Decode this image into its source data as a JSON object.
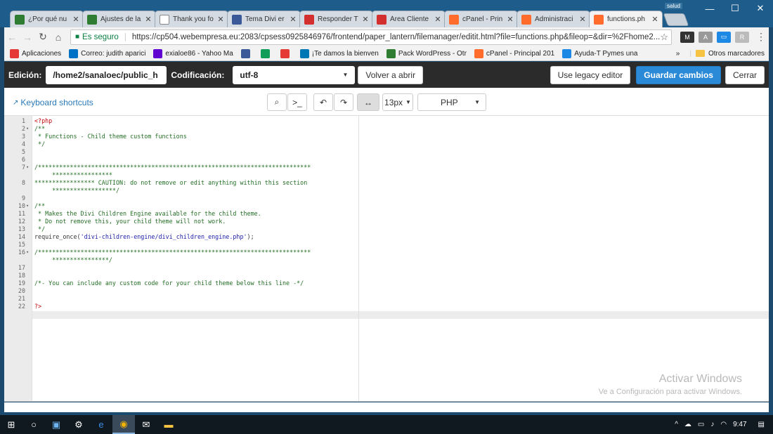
{
  "browser": {
    "tabs": [
      {
        "title": "¿Por qué nu",
        "icon": "page-icon",
        "color": "#2e7d32"
      },
      {
        "title": "Ajustes de la",
        "icon": "page-icon",
        "color": "#2e7d32"
      },
      {
        "title": "Thank you fo",
        "icon": "doc-icon",
        "color": "#ffffff"
      },
      {
        "title": "Tema Divi er",
        "icon": "facebook-icon",
        "color": "#3b5998"
      },
      {
        "title": "Responder T",
        "icon": "w-icon",
        "color": "#d32f2f"
      },
      {
        "title": "Área Cliente",
        "icon": "w-icon",
        "color": "#d32f2f"
      },
      {
        "title": "cPanel - Prin",
        "icon": "cpanel-icon",
        "color": "#ff6c2c"
      },
      {
        "title": "Administraci",
        "icon": "cpanel-icon",
        "color": "#ff6c2c"
      },
      {
        "title": "functions.ph",
        "icon": "cpanel-icon",
        "color": "#ff6c2c",
        "active": true
      }
    ],
    "profile_label": "salud",
    "window_controls": {
      "minimize": "—",
      "maximize": "☐",
      "close": "✕"
    },
    "secure_label": "Es seguro",
    "url": "https://cp504.webempresa.eu:2083/cpsess0925846976/frontend/paper_lantern/filemanager/editit.html?file=functions.php&fileop=&dir=%2Fhome2...",
    "bookmarks": [
      {
        "label": "Aplicaciones",
        "icon": "apps-icon",
        "color": "#e53935"
      },
      {
        "label": "Correo: judith aparici",
        "icon": "outlook-icon",
        "color": "#0072c6"
      },
      {
        "label": "exialoe86 - Yahoo Ma",
        "icon": "yahoo-icon",
        "color": "#6001d2"
      },
      {
        "label": "",
        "icon": "facebook-icon",
        "color": "#3b5998"
      },
      {
        "label": "",
        "icon": "chat-icon",
        "color": "#0f9d58"
      },
      {
        "label": "",
        "icon": "youtube-icon",
        "color": "#e53935"
      },
      {
        "label": "¡Te damos la bienven",
        "icon": "linkedin-icon",
        "color": "#0077b5"
      },
      {
        "label": "Pack WordPress - Otr",
        "icon": "page-icon",
        "color": "#2e7d32"
      },
      {
        "label": "cPanel - Principal 201",
        "icon": "cpanel-icon",
        "color": "#ff6c2c"
      },
      {
        "label": "Ayuda-T Pymes una",
        "icon": "ayuda-icon",
        "color": "#1e88e5"
      }
    ],
    "bookmarks_overflow": "»",
    "other_bookmarks": "Otros marcadores"
  },
  "editor_header": {
    "edit_label": "Edición:",
    "path_value": "/home2/sanaloec/public_h",
    "encoding_label": "Codificación:",
    "encoding_value": "utf-8",
    "reopen_button": "Volver a abrir",
    "legacy_button": "Use legacy editor",
    "save_button": "Guardar cambios",
    "close_button": "Cerrar"
  },
  "editor_tools": {
    "keyboard_shortcuts": "Keyboard shortcuts",
    "font_size": "13px",
    "mode": "PHP"
  },
  "code_lines": [
    {
      "n": "1",
      "fold": "",
      "text": "<?php",
      "cls": "tag"
    },
    {
      "n": "2",
      "fold": "▾",
      "text": "/**",
      "cls": "cm"
    },
    {
      "n": "3",
      "fold": "",
      "text": " * Functions - Child theme custom functions",
      "cls": "cm"
    },
    {
      "n": "4",
      "fold": "",
      "text": " */",
      "cls": "cm"
    },
    {
      "n": "5",
      "fold": "",
      "text": "",
      "cls": "cm"
    },
    {
      "n": "6",
      "fold": "",
      "text": "",
      "cls": "cm"
    },
    {
      "n": "7",
      "fold": "▾",
      "text": "/*****************************************************************************",
      "cls": "cm"
    },
    {
      "n": "",
      "fold": "",
      "text": "     *****************",
      "cls": "cm"
    },
    {
      "n": "8",
      "fold": "",
      "text": "***************** CAUTION: do not remove or edit anything within this section",
      "cls": "cm"
    },
    {
      "n": "",
      "fold": "",
      "text": "     ******************/",
      "cls": "cm"
    },
    {
      "n": "9",
      "fold": "",
      "text": "",
      "cls": "cm"
    },
    {
      "n": "10",
      "fold": "▾",
      "text": "/**",
      "cls": "cm"
    },
    {
      "n": "11",
      "fold": "",
      "text": " * Makes the Divi Children Engine available for the child theme.",
      "cls": "cm"
    },
    {
      "n": "12",
      "fold": "",
      "text": " * Do not remove this, your child theme will not work.",
      "cls": "cm"
    },
    {
      "n": "13",
      "fold": "",
      "text": " */",
      "cls": "cm"
    },
    {
      "n": "14",
      "fold": "",
      "text": "require_once('divi-children-engine/divi_children_engine.php');",
      "cls": "mixed"
    },
    {
      "n": "15",
      "fold": "",
      "text": "",
      "cls": "cm"
    },
    {
      "n": "16",
      "fold": "▾",
      "text": "/*****************************************************************************",
      "cls": "cm"
    },
    {
      "n": "",
      "fold": "",
      "text": "     ****************/",
      "cls": "cm"
    },
    {
      "n": "17",
      "fold": "",
      "text": "",
      "cls": "cm"
    },
    {
      "n": "18",
      "fold": "",
      "text": "",
      "cls": "cm"
    },
    {
      "n": "19",
      "fold": "",
      "text": "/*- You can include any custom code for your child theme below this line -*/",
      "cls": "cm"
    },
    {
      "n": "20",
      "fold": "",
      "text": "",
      "cls": "cm"
    },
    {
      "n": "21",
      "fold": "",
      "text": "",
      "cls": "cm"
    },
    {
      "n": "22",
      "fold": "",
      "text": "?>",
      "cls": "tag"
    }
  ],
  "watermark": {
    "title": "Activar Windows",
    "subtitle": "Ve a Configuración para activar Windows."
  },
  "taskbar": {
    "time": "9:47"
  }
}
